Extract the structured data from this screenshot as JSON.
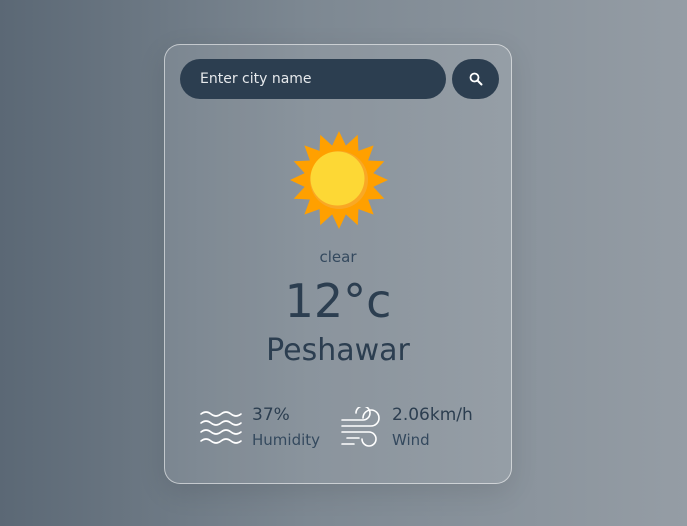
{
  "search": {
    "placeholder": "Enter city name",
    "value": "",
    "button_icon": "search-icon"
  },
  "weather": {
    "icon": "sun-icon",
    "condition": "clear",
    "temperature": "12°c",
    "city": "Peshawar"
  },
  "details": {
    "humidity": {
      "icon": "humidity-waves-icon",
      "value": "37%",
      "label": "Humidity"
    },
    "wind": {
      "icon": "wind-icon",
      "value": "2.06km/h",
      "label": "Wind"
    }
  },
  "colors": {
    "accent": "#2c3e50",
    "sun_outer": "#ffa000",
    "sun_inner": "#fdd835"
  }
}
